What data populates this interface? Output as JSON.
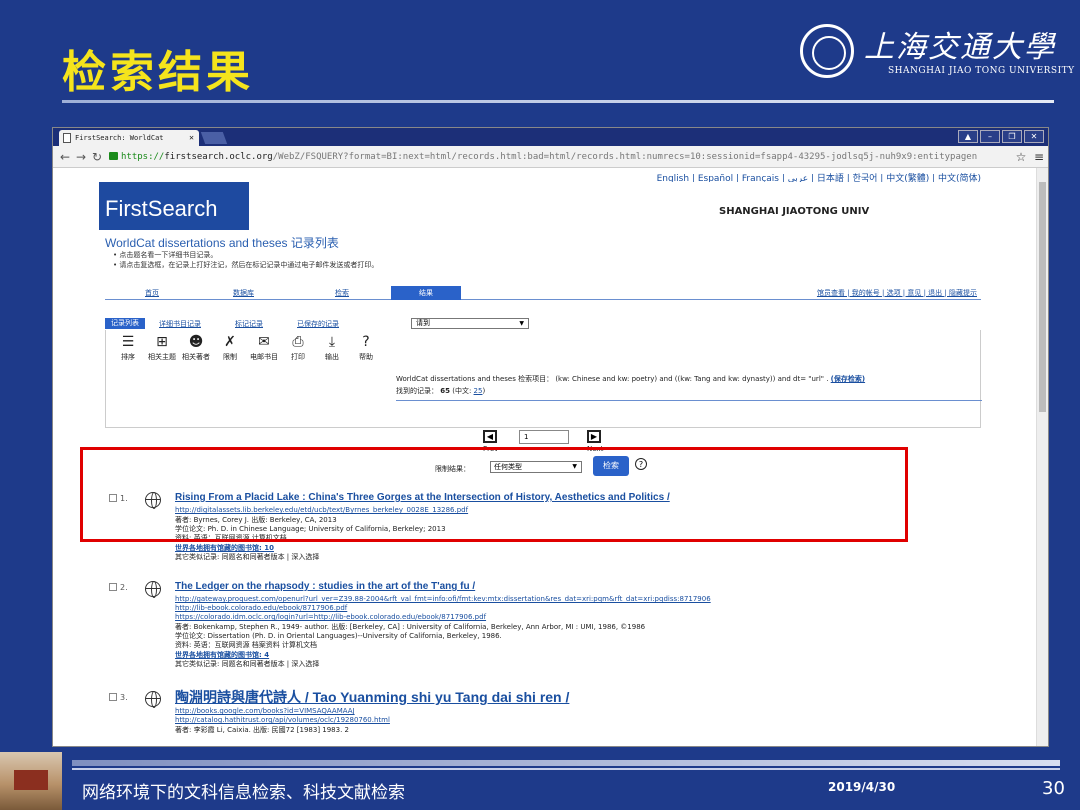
{
  "slide": {
    "title": "检索结果",
    "logo_cn": "上海交通大學",
    "logo_en": "SHANGHAI JIAO TONG UNIVERSITY",
    "footer_text": "网络环境下的文科信息检索、科技文献检索",
    "footer_date": "2019/4/30",
    "page_number": "30"
  },
  "browser": {
    "tab_title": "FirstSearch: WorldCat",
    "url_scheme": "https://",
    "url_host": "firstsearch.oclc.org",
    "url_path": "/WebZ/FSQUERY?format=BI:next=html/records.html:bad=html/records.html:numrecs=10:sessionid=fsapp4-43295-jodlsq5j-nuh9x9:entitypagen"
  },
  "page": {
    "languages": "English | Español | Français | عربي | 日本語 | 한국어 | 中文(繁體) | 中文(简体)",
    "logo": "FirstSearch",
    "institution": "SHANGHAI JIAOTONG UNIV",
    "heading": "WorldCat dissertations and theses 记录列表",
    "help": [
      "点击题名看一下详细书目记录。",
      "请点击复选框，在记录上打好注记，然后在标记记录中通过电子邮件发送或者打印。"
    ],
    "nav": {
      "home": "首页",
      "databases": "数据库",
      "search": "检索",
      "results": "结果"
    },
    "right_links": "馆员查看 | 我的帐号 | 选项 | 意见 | 退出 | 隐藏提示",
    "subnav": {
      "list": "记录列表",
      "detail": "详细书目记录",
      "marked": "标记记录",
      "saved": "已保存的记录",
      "goto": "请到"
    },
    "tools": [
      {
        "icon": "sort-icon",
        "label": "排序"
      },
      {
        "icon": "related-subject-icon",
        "label": "相关主题"
      },
      {
        "icon": "related-author-icon",
        "label": "相关著者"
      },
      {
        "icon": "limit-icon",
        "label": "限制"
      },
      {
        "icon": "email-icon",
        "label": "电邮书目"
      },
      {
        "icon": "print-icon",
        "label": "打印"
      },
      {
        "icon": "export-icon",
        "label": "输出"
      },
      {
        "icon": "help-icon",
        "label": "帮助"
      }
    ],
    "query_text": "WorldCat dissertations and theses 检索项目： (kw: Chinese and kw: poetry) and ((kw: Tang and kw: dynasty)) and dt= \"url\" .",
    "save_search": "(保存检索)",
    "found_label": "找到的记录：",
    "found_count": "65",
    "found_cn": "(中文: ",
    "found_cn_count": "25",
    "found_close": ")",
    "pager": {
      "page": "1",
      "prev": "Prev",
      "next": "Next"
    },
    "limit": {
      "label": "限制结果：",
      "value": "任何类型",
      "button": "检索"
    },
    "records": [
      {
        "num": "1.",
        "title": "Rising From a Placid Lake : China's Three Gorges at the Intersection of History, Aesthetics and Politics /",
        "lines": [
          "http://digitalassets.lib.berkeley.edu/etd/ucb/text/Byrnes_berkeley_0028E_13286.pdf",
          "著者: Byrnes, Corey J. 出版: Berkeley, CA, 2013",
          "学位论文: Ph. D. in Chinese Language; University of California, Berkeley; 2013",
          "资料: 英语：互联网资源 计算机文档",
          "世界各地拥有馆藏的图书馆: 10",
          "其它类似记录: 同题名和同著者版本 | 深入选择"
        ]
      },
      {
        "num": "2.",
        "title": "The Ledger on the rhapsody : studies in the art of the T'ang fu /",
        "lines": [
          "http://gateway.proquest.com/openurl?url_ver=Z39.88-2004&rft_val_fmt=info:ofi/fmt:kev:mtx:dissertation&res_dat=xri:pqm&rft_dat=xri:pqdiss:8717906",
          "http://lib-ebook.colorado.edu/ebook/8717906.pdf",
          "https://colorado.idm.oclc.org/login?url=http://lib-ebook.colorado.edu/ebook/8717906.pdf",
          "著者: Bokenkamp, Stephen R., 1949- author. 出版: [Berkeley, CA] : University of California, Berkeley, Ann Arbor, MI : UMI, 1986, ©1986",
          "学位论文: Dissertation (Ph. D. in Oriental Languages)--University of California, Berkeley, 1986.",
          "资料: 英语：互联网资源 档案资料 计算机文档",
          "世界各地拥有馆藏的图书馆: 4",
          "其它类似记录: 同题名和同著者版本 | 深入选择"
        ]
      },
      {
        "num": "3.",
        "title": "陶淵明詩與唐代詩人 / Tao Yuanming shi yu Tang dai shi ren /",
        "lines": [
          "http://books.google.com/books?id=VIMSAQAAMAAJ",
          "http://catalog.hathitrust.org/api/volumes/oclc/19280760.html",
          "著者: 李彩霞 Li, Caixia. 出版: 民國72 [1983] 1983. 2"
        ]
      }
    ]
  }
}
